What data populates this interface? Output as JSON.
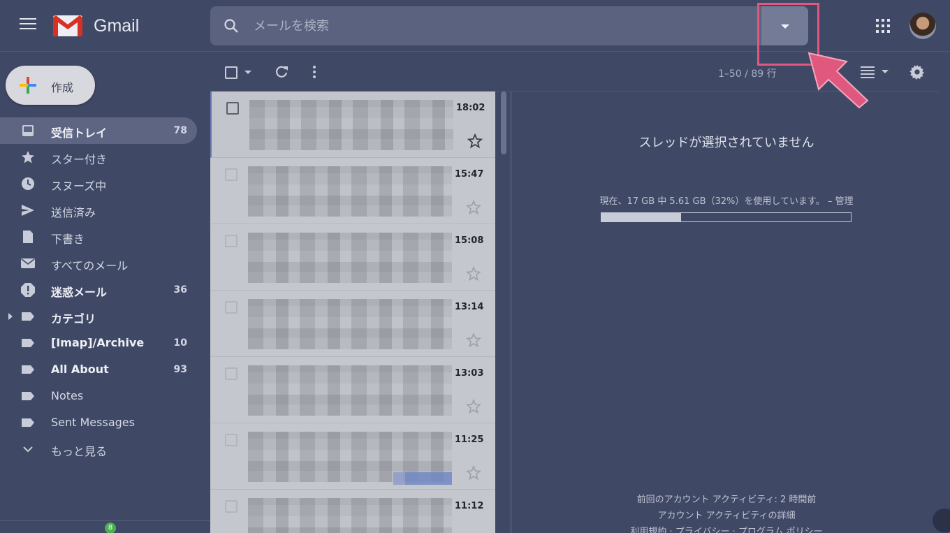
{
  "header": {
    "app_name": "Gmail",
    "search_placeholder": "メールを検索"
  },
  "compose": {
    "label": "作成"
  },
  "nav": {
    "items": [
      {
        "label": "受信トレイ",
        "count": "78",
        "bold": true,
        "active": true,
        "icon": "inbox-icon"
      },
      {
        "label": "スター付き",
        "count": "",
        "icon": "star-icon"
      },
      {
        "label": "スヌーズ中",
        "count": "",
        "icon": "clock-icon"
      },
      {
        "label": "送信済み",
        "count": "",
        "icon": "send-icon"
      },
      {
        "label": "下書き",
        "count": "",
        "icon": "draft-icon"
      },
      {
        "label": "すべてのメール",
        "count": "",
        "icon": "mail-icon"
      },
      {
        "label": "迷惑メール",
        "count": "36",
        "bold": true,
        "icon": "spam-icon"
      },
      {
        "label": "カテゴリ",
        "count": "",
        "bold": true,
        "icon": "label-icon"
      },
      {
        "label": "[Imap]/Archive",
        "count": "10",
        "bold": true,
        "icon": "label-icon"
      },
      {
        "label": "All About",
        "count": "93",
        "bold": true,
        "icon": "label-icon"
      },
      {
        "label": "Notes",
        "count": "",
        "icon": "label-icon"
      },
      {
        "label": "Sent Messages",
        "count": "",
        "icon": "label-icon"
      },
      {
        "label": "もっと見る",
        "count": "",
        "icon": "chevron-down-icon"
      }
    ],
    "hangouts_badge": "8"
  },
  "toolbar": {
    "pagination": "1–50 / 89 行"
  },
  "mail_list": {
    "times": [
      "18:02",
      "15:47",
      "15:08",
      "13:14",
      "13:03",
      "11:25",
      "11:12"
    ]
  },
  "reading_pane": {
    "no_thread": "スレッドが選択されていません",
    "storage": "現在、17 GB 中 5.61 GB（32%）を使用しています。 – 管理",
    "storage_fraction": 0.32,
    "footer": {
      "activity": "前回のアカウント アクティビティ: 2 時間前",
      "details": "アカウント アクティビティの詳細",
      "links": "利用規約 · プライバシー · プログラム ポリシー"
    }
  },
  "colors": {
    "background": "#3f4865",
    "highlight": "#e0587e",
    "gmail_red": "#d93025"
  }
}
